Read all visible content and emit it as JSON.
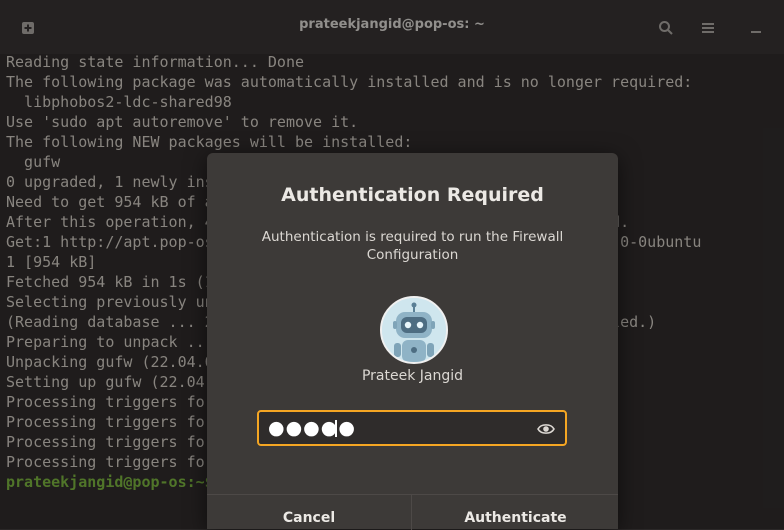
{
  "window": {
    "title": "prateekjangid@pop-os: ~",
    "new_tab_icon": "new-tab-icon",
    "search_icon": "search-icon",
    "menu_icon": "hamburger-menu-icon",
    "minimize_icon": "minimize-icon"
  },
  "terminal": {
    "lines": [
      "Reading state information... Done",
      "The following package was automatically installed and is no longer required:",
      "  libphobos2-ldc-shared98",
      "Use 'sudo apt autoremove' to remove it.",
      "The following NEW packages will be installed:",
      "  gufw",
      "0 upgraded, 1 newly installed, 0 to remove and 0 not upgraded.",
      "Need to get 954 kB of archives.",
      "After this operation, 4,578 kB of additional disk space will be used.",
      "Get:1 http://apt.pop-os.org/release jammy/main amd64 gufw all 22.04.0-0ubuntu",
      "1 [954 kB]",
      "Fetched 954 kB in 1s (1,102 kB/s)",
      "Selecting previously unselected package gufw.",
      "(Reading database ... 215632 files and directories currently installed.)",
      "Preparing to unpack .../gufw_22.04.0-0ubuntu1_all.deb ...",
      "Unpacking gufw (22.04.0-0ubuntu1) ...",
      "Setting up gufw (22.04.0-0ubuntu1) ...",
      "Processing triggers for desktop-file-utils (0.26-1ubuntu3) ...",
      "Processing triggers for hicolor-icon-theme (0.17-2) ...",
      "Processing triggers for gnome-menus (3.36.0-1ubuntu3) ...",
      "Processing triggers for man-db (2.10.2-1) ..."
    ],
    "prompt": "prateekjangid@pop-os:~$"
  },
  "dialog": {
    "title": "Authentication Required",
    "message": "Authentication is required to run the Firewall Configuration",
    "user_name": "Prateek Jangid",
    "password_mask": "●●●●●",
    "cancel_label": "Cancel",
    "authenticate_label": "Authenticate",
    "accent_color": "#f5a623"
  }
}
